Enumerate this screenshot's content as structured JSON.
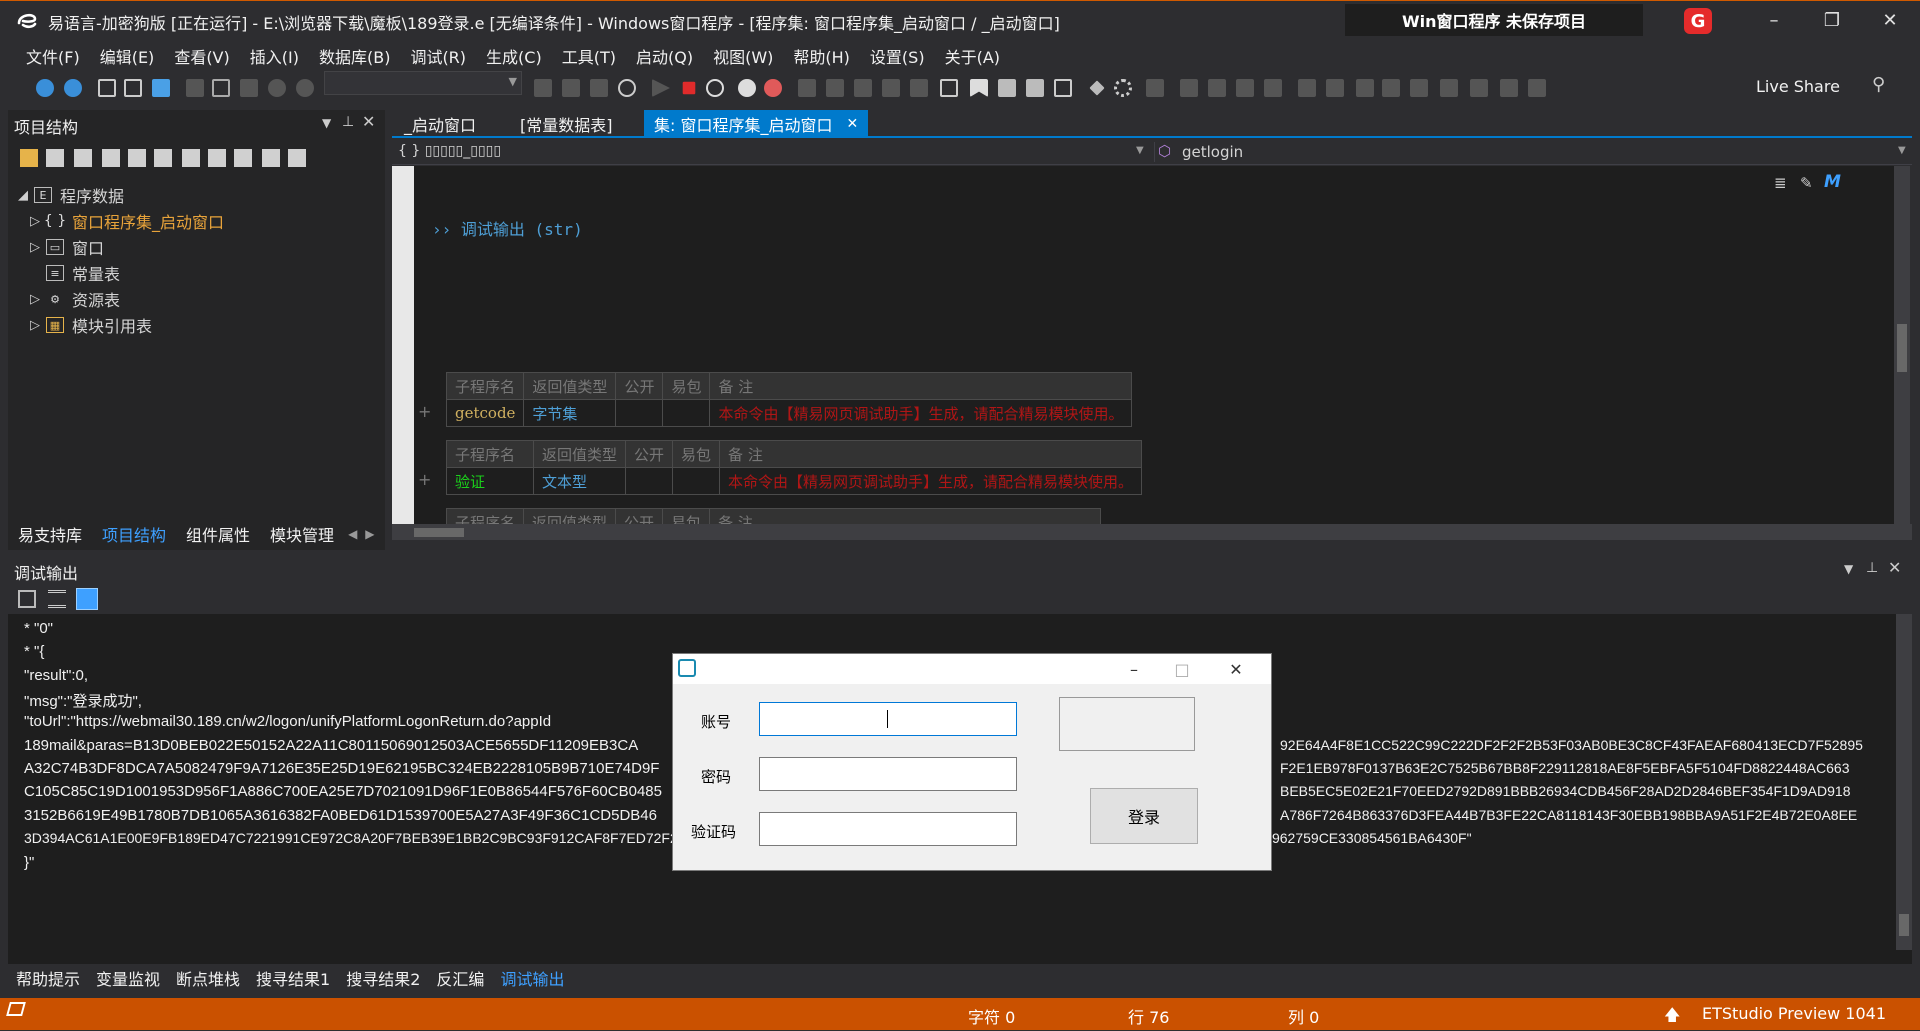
{
  "window": {
    "title": "易语言-加密狗版 [正在运行] - E:\\浏览器下载\\魔板\\189登录.e [无编译条件] - Windows窗口程序 - [程序集: 窗口程序集_启动窗口 / _启动窗口]",
    "project_badge": "Win窗口程序 未保存项目",
    "logo_letter": "G",
    "minimize": "–",
    "restore": "❐",
    "close": "✕"
  },
  "menu": [
    "文件(F)",
    "编辑(E)",
    "查看(V)",
    "插入(I)",
    "数据库(B)",
    "调试(R)",
    "生成(C)",
    "工具(T)",
    "启动(Q)",
    "视图(W)",
    "帮助(H)",
    "设置(S)",
    "关于(A)"
  ],
  "toolbar": {
    "live_share": "Live Share"
  },
  "project_panel": {
    "title": "项目结构",
    "tree": [
      {
        "label": "程序数据",
        "arrow": "◢",
        "icon": "E"
      },
      {
        "label": "窗口程序集_启动窗口",
        "arrow": "▷",
        "icon": "{ }"
      },
      {
        "label": "窗口",
        "arrow": "▷",
        "icon": "▭"
      },
      {
        "label": "常量表",
        "arrow": "",
        "icon": "≡"
      },
      {
        "label": "资源表",
        "arrow": "▷",
        "icon": "⚙"
      },
      {
        "label": "模块引用表",
        "arrow": "▷",
        "icon": "▦"
      }
    ],
    "tabs": [
      "易支持库",
      "项目结构",
      "组件属性",
      "模块管理"
    ]
  },
  "editor": {
    "tabs": [
      "_启动窗口",
      "[常量数据表]",
      "集: 窗口程序集_启动窗口"
    ],
    "tab_close": "✕",
    "nav_left": "{ }  ▯▯▯▯▯_▯▯▯▯",
    "nav_right": "getlogin",
    "debug_line": "›› 调试输出 (str)",
    "proc_header": [
      "子程序名",
      "返回值类型",
      "公开",
      "易包",
      "备 注"
    ],
    "procs": [
      {
        "name": "getcode",
        "type": "字节集",
        "note": "本命令由【精易网页调试助手】生成，请配合精易模块使用。"
      },
      {
        "name": "验证",
        "type": "文本型",
        "note": "本命令由【精易网页调试助手】生成，请配合精易模块使用。"
      }
    ]
  },
  "debug_panel": {
    "title": "调试输出",
    "lines": [
      "*  \"0\"",
      "*  \"{",
      "            \"result\":0,",
      "            \"msg\":\"登录成功\",",
      "            \"toUrl\":\"https://webmail30.189.cn/w2/logon/unifyPlatformLogonReturn.do?appId",
      "189mail&paras=B13D0BEB022E50152A22A11C80115069012503ACE5655DF11209EB3CA",
      "A32C74B3DF8DCA7A5082479F9A7126E35E25D19E62195BC324EB2228105B9B710E74D9F",
      "C105C85C19D1001953D956F1A886C700EA25E7D7021091D96F1E0B86544F576F60CB0485",
      "3152B6619E49B1780B7DB1065A3616382FA0BED61D1539700E5A27A3F49F36C1CD5DB46",
      "3D394AC61A1E00E9FB189ED47C7221991CE972C8A20F7BEB39E1BB2C9BC93F912CAF8F7ED72F253A0ED6462570F46A24B0638F8DCCEA13D634478F7CCDB862&sign=5E8B8BB0BBE17D84962759CE330854561BA6430F\"",
      "}\""
    ],
    "right_lines": [
      "92E64A4F8E1CC522C99C222DF2F2F2B53F03AB0BE3C8CF43FAEAF680413ECD7F52895",
      "F2E1EB978F0137B63E2C7525B67BB8F229112818AE8F5EBFA5F5104FD8822448AC663",
      "BEB5EC5E02E21F70EED2792D891BBB26934CDB456F28AD2D2846BEF354F1D9AD918",
      "A786F7264B863376D3FEA44B7B3FE22CA8118143F30EBB198BBA9A51F2E4B72E0A8EE"
    ],
    "tabs": [
      "帮助提示",
      "变量监视",
      "断点堆栈",
      "搜寻结果1",
      "搜寻结果2",
      "反汇编",
      "调试输出"
    ]
  },
  "statusbar": {
    "chars": "字符 0",
    "line": "行 76",
    "col": "列 0",
    "product": "ETStudio Preview 1041",
    "up_icon": "🡅"
  },
  "login_dialog": {
    "minimize": "–",
    "maximize": "□",
    "close": "✕",
    "account_label": "账号",
    "password_label": "密码",
    "captcha_label": "验证码",
    "account_value": "",
    "password_value": "",
    "captcha_value": "",
    "login_button": "登录"
  },
  "colors": {
    "accent": "#007acc",
    "status_bar": "#ca5100",
    "tree_highlight": "#e8a33a"
  }
}
